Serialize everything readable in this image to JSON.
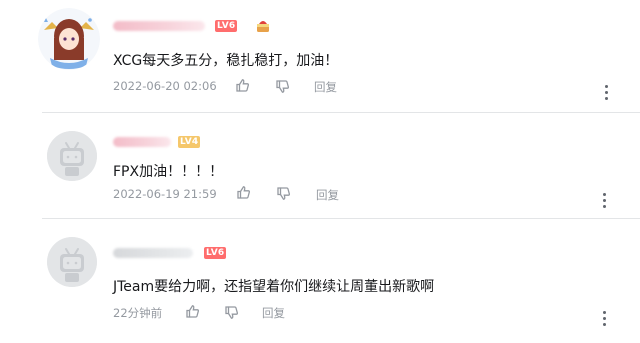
{
  "comments": [
    {
      "level": "LV6",
      "text": "XCG每天多五分，稳扎稳打，加油！",
      "time": "2022-06-20 02:06",
      "reply": "回复"
    },
    {
      "level": "LV4",
      "text": "FPX加油！！！！",
      "time": "2022-06-19 21:59",
      "reply": "回复"
    },
    {
      "level": "LV6",
      "text": "JTeam要给力啊，还指望着你们继续让周董出新歌啊",
      "time": "22分钟前",
      "reply": "回复"
    }
  ]
}
